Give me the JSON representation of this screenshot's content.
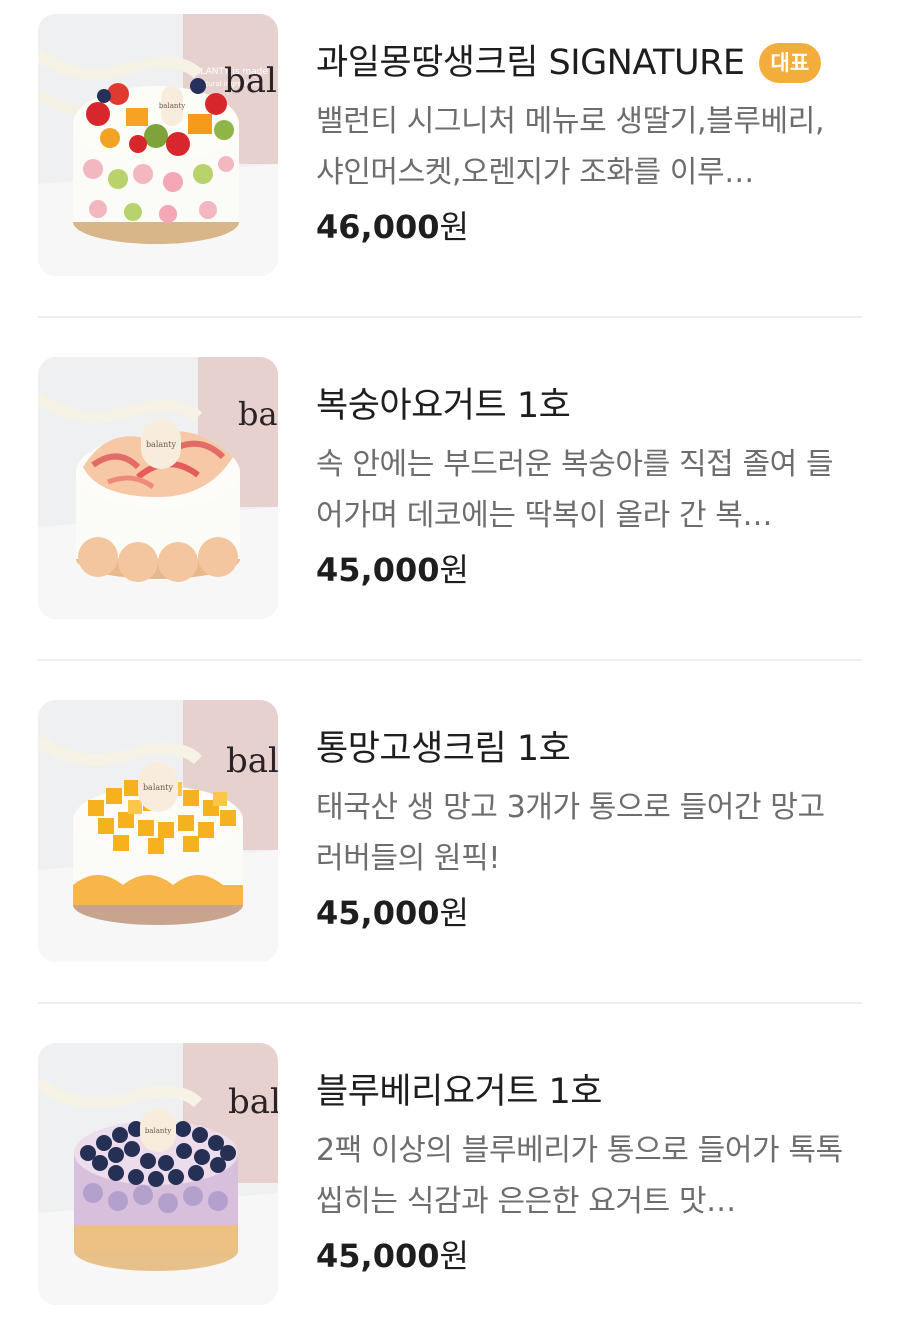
{
  "menu": {
    "items": [
      {
        "title": "과일몽땅생크림 SIGNATURE",
        "badge": "대표",
        "description": "밸런티 시그니처 메뉴로 생딸기,블루베리,샤인머스켓,오렌지가 조화를 이루…",
        "price": "46,000",
        "unit": "원",
        "box_text": "bal",
        "plaque_text": "balanty",
        "image": "fruit-cake"
      },
      {
        "title": "복숭아요거트 1호",
        "badge": "",
        "description": "속 안에는 부드러운 복숭아를 직접 졸여 들어가며 데코에는 딱복이 올라 간 복…",
        "price": "45,000",
        "unit": "원",
        "box_text": "bal",
        "plaque_text": "balanty",
        "image": "peach-cake"
      },
      {
        "title": "통망고생크림 1호",
        "badge": "",
        "description": "태국산 생 망고 3개가 통으로 들어간 망고 러버들의 원픽!",
        "price": "45,000",
        "unit": "원",
        "box_text": "bal",
        "plaque_text": "balanty",
        "image": "mango-cake"
      },
      {
        "title": "블루베리요거트 1호",
        "badge": "",
        "description": "2팩 이상의 블루베리가 통으로 들어가 톡톡 씹히는 식감과 은은한 요거트 맛…",
        "price": "45,000",
        "unit": "원",
        "box_text": "bal",
        "plaque_text": "balanty",
        "image": "blueberry-cake"
      }
    ]
  },
  "colors": {
    "badge_bg": "#f3ad3c",
    "title": "#1e1e1e",
    "description": "#6d6d6d",
    "divider": "#eeeeee"
  }
}
